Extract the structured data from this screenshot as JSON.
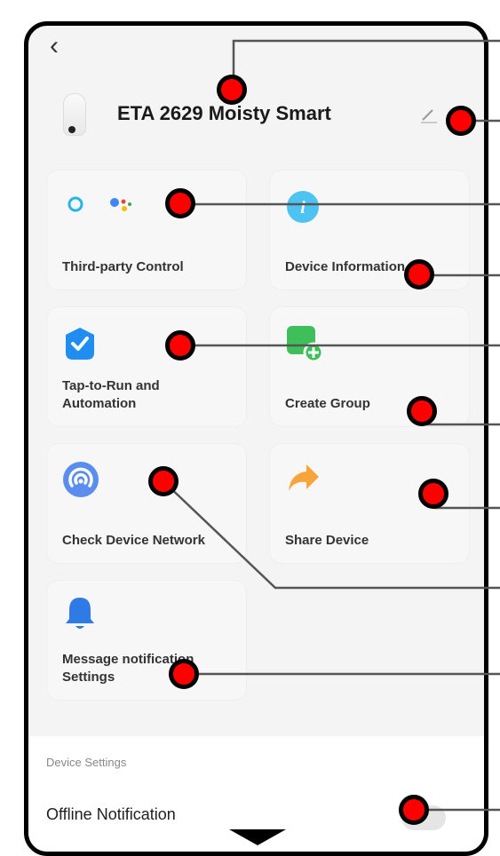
{
  "header": {
    "back_label": "‹",
    "device_name": "ETA 2629 Moisty Smart"
  },
  "icons": {
    "back": "chevron-left-icon",
    "edit": "pencil-icon",
    "alexa": "alexa-icon",
    "google": "google-assistant-icon",
    "info": "info-icon",
    "automation": "shield-check-icon",
    "group": "create-group-icon",
    "network": "network-icon",
    "share": "share-arrow-icon",
    "bell": "bell-icon"
  },
  "cards": {
    "third_party": "Third-party Control",
    "device_info": "Device Information",
    "tap_to_run_line1": "Tap-to-Run and",
    "tap_to_run_line2": "Automation",
    "create_group": "Create Group",
    "check_network": "Check Device Network",
    "share_device": "Share Device",
    "message_line1": "Message notification",
    "message_line2": "Settings"
  },
  "settings": {
    "section_title": "Device Settings",
    "offline_notification": "Offline Notification",
    "offline_notification_on": false
  },
  "colors": {
    "annotation_dot": "#ff0000",
    "info_blue": "#4cc3f0",
    "automation_blue": "#1f8ef0",
    "group_green": "#3fbf5a",
    "network_blue": "#5b8def",
    "share_orange": "#f7a53a",
    "bell_blue": "#2f7be5"
  }
}
